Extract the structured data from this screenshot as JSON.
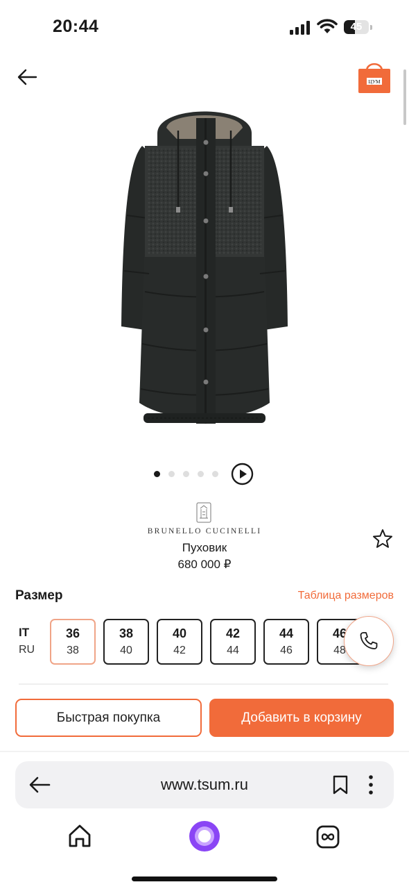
{
  "status_bar": {
    "time": "20:44",
    "battery_level": "45",
    "battery_fraction": 0.45
  },
  "header": {
    "back_icon": "arrow-left-icon",
    "cart_icon": "shopping-bag-icon",
    "cart_badge_text": "ЦУМ",
    "accent_color": "#f16b3a"
  },
  "carousel": {
    "total_slides": 5,
    "active_slide": 1,
    "play_icon": "play-icon"
  },
  "product": {
    "brand": "BRUNELLO CUCINELLI",
    "title": "Пуховик",
    "price": "680 000 ₽",
    "favorite_icon": "star-outline-icon"
  },
  "sizes": {
    "heading": "Размер",
    "chart_link": "Таблица размеров",
    "label_it": "IT",
    "label_ru": "RU",
    "items": [
      {
        "it": "36",
        "ru": "38",
        "selected": true
      },
      {
        "it": "38",
        "ru": "40",
        "selected": false
      },
      {
        "it": "40",
        "ru": "42",
        "selected": false
      },
      {
        "it": "42",
        "ru": "44",
        "selected": false
      },
      {
        "it": "44",
        "ru": "46",
        "selected": false
      },
      {
        "it": "46",
        "ru": "48",
        "selected": false
      }
    ],
    "call_icon": "phone-icon"
  },
  "actions": {
    "quick_buy": "Быстрая покупка",
    "add_to_cart": "Добавить в корзину"
  },
  "browser": {
    "url": "www.tsum.ru",
    "back_icon": "arrow-left-icon",
    "bookmark_icon": "bookmark-icon",
    "menu_icon": "more-vertical-icon",
    "nav": {
      "home_icon": "home-icon",
      "assistant_icon": "alice-assistant-icon",
      "tabs_icon": "tabs-icon"
    }
  }
}
